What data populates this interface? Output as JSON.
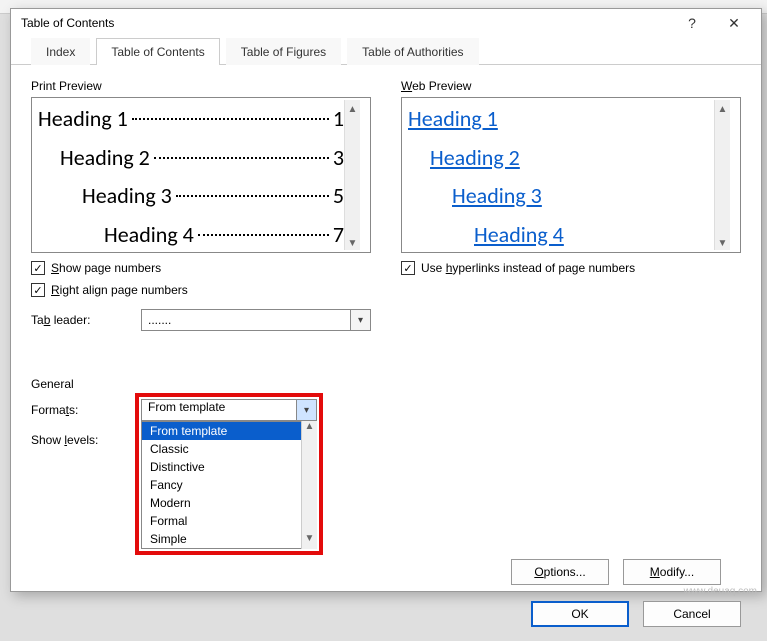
{
  "dialog": {
    "title": "Table of Contents",
    "help_glyph": "?",
    "close_glyph": "✕"
  },
  "tabs": {
    "index": "Index",
    "toc": "Table of Contents",
    "figures": "Table of Figures",
    "authorities": "Table of Authorities"
  },
  "left": {
    "header": "Print Preview",
    "headings": [
      {
        "indent": 0,
        "label": "Heading 1",
        "page": "1"
      },
      {
        "indent": 1,
        "label": "Heading 2",
        "page": "3"
      },
      {
        "indent": 2,
        "label": "Heading 3",
        "page": "5"
      },
      {
        "indent": 3,
        "label": "Heading 4",
        "page": "7"
      }
    ],
    "show_page_numbers": {
      "u": "S",
      "rest": "how page numbers",
      "checked": true
    },
    "right_align": {
      "u": "R",
      "rest": "ight align page numbers",
      "checked": true
    },
    "tab_leader": {
      "label_pre": "Ta",
      "label_u": "b",
      "label_post": " leader:",
      "value": "......."
    }
  },
  "right": {
    "header": {
      "u": "W",
      "rest": "eb Preview"
    },
    "links": [
      "Heading 1",
      "Heading 2",
      "Heading 3",
      "Heading 4"
    ],
    "use_hyperlinks": {
      "pre": "Use ",
      "u": "h",
      "post": "yperlinks instead of page numbers",
      "checked": true
    }
  },
  "general": {
    "label": "General",
    "formats": {
      "label_pre": "Forma",
      "label_u": "t",
      "label_post": "s:",
      "value": "From template"
    },
    "show_levels": {
      "label_pre": "Show ",
      "label_u": "l",
      "label_post": "evels:"
    },
    "options": [
      "From template",
      "Classic",
      "Distinctive",
      "Fancy",
      "Modern",
      "Formal",
      "Simple"
    ]
  },
  "buttons": {
    "options": {
      "u": "O",
      "rest": "ptions..."
    },
    "modify": {
      "u": "M",
      "rest": "odify..."
    },
    "ok": "OK",
    "cancel": "Cancel"
  },
  "watermark": "www.deuaq.com"
}
